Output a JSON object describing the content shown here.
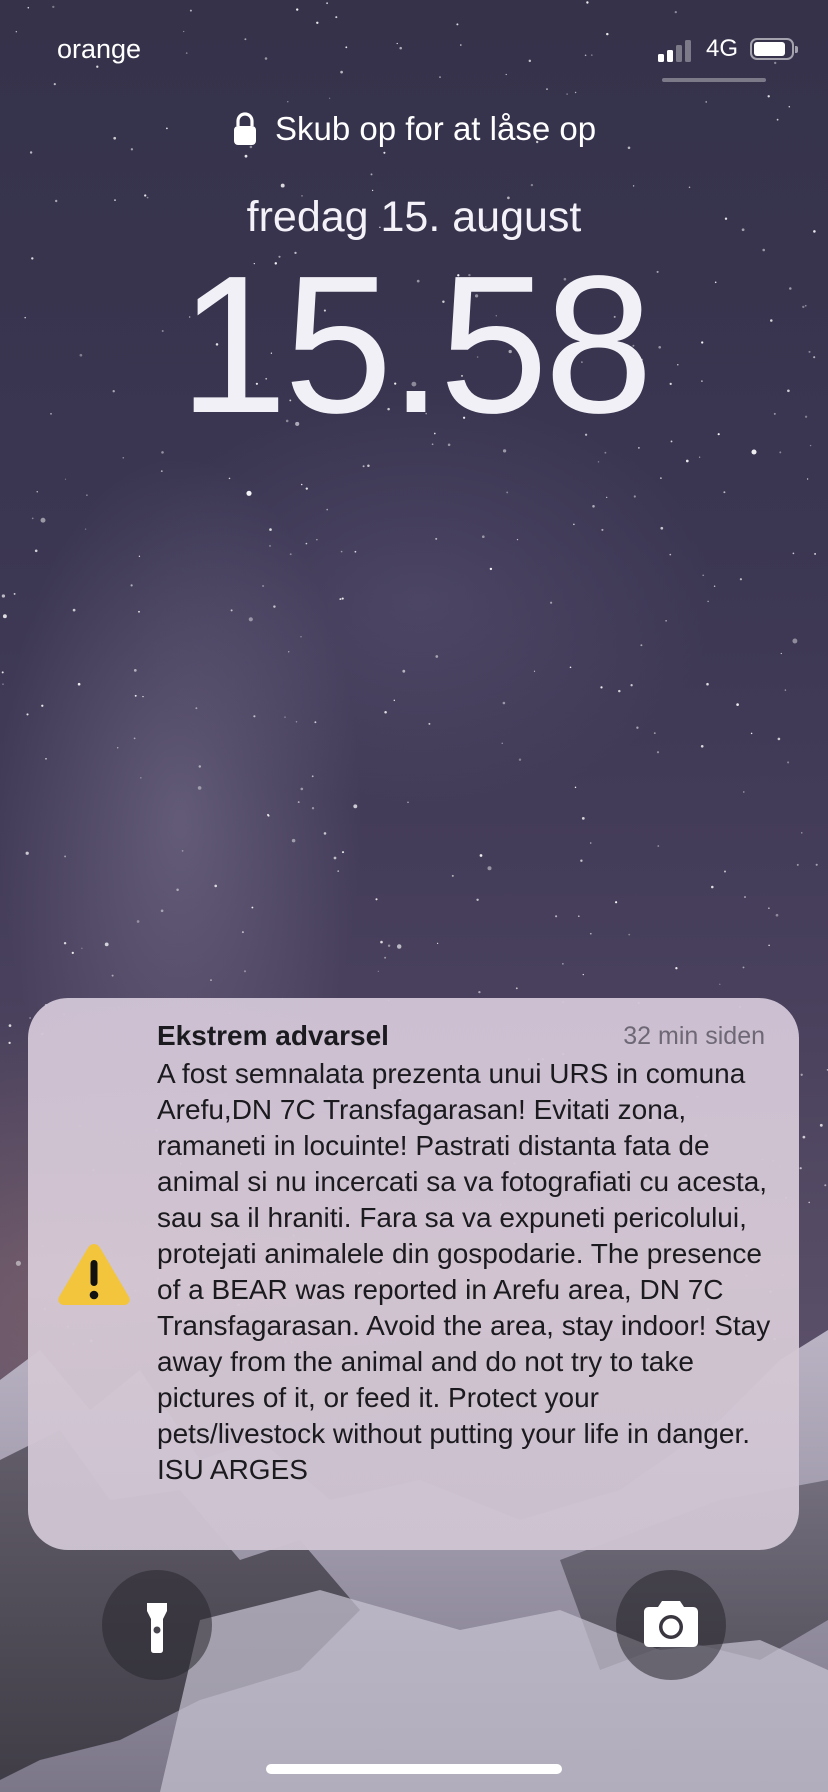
{
  "status_bar": {
    "carrier": "orange",
    "network": "4G",
    "signal_bars_active": 2,
    "signal_bars_total": 4,
    "battery_level": 0.85
  },
  "lock_screen": {
    "unlock_hint": "Skub op for at låse op",
    "date": "fredag 15. august",
    "time": "15.58"
  },
  "notification": {
    "title": "Ekstrem advarsel",
    "time_ago": "32 min siden",
    "body": "A fost semnalata prezenta unui URS in comuna Arefu,DN 7C Transfagarasan! Evitati zona, ramaneti in locuinte! Pastrati distanta fata de animal si nu incercati sa va fotografiati cu acesta, sau sa il hraniti. Fara sa va expuneti pericolului, protejati animalele din gospodarie. The presence of a BEAR was reported in Arefu area, DN 7C Transfagarasan. Avoid the area, stay indoor! Stay away from the animal and do not try to take pictures of it, or feed it. Protect your pets/livestock without putting your life in danger. ISU ARGES",
    "icon": "warning-icon",
    "icon_color": "#f2c53d"
  },
  "quick_actions": {
    "flashlight_icon": "flashlight-icon",
    "camera_icon": "camera-icon"
  },
  "colors": {
    "notification_bg": "#d2c4d6",
    "warning_yellow": "#f2c53d"
  }
}
